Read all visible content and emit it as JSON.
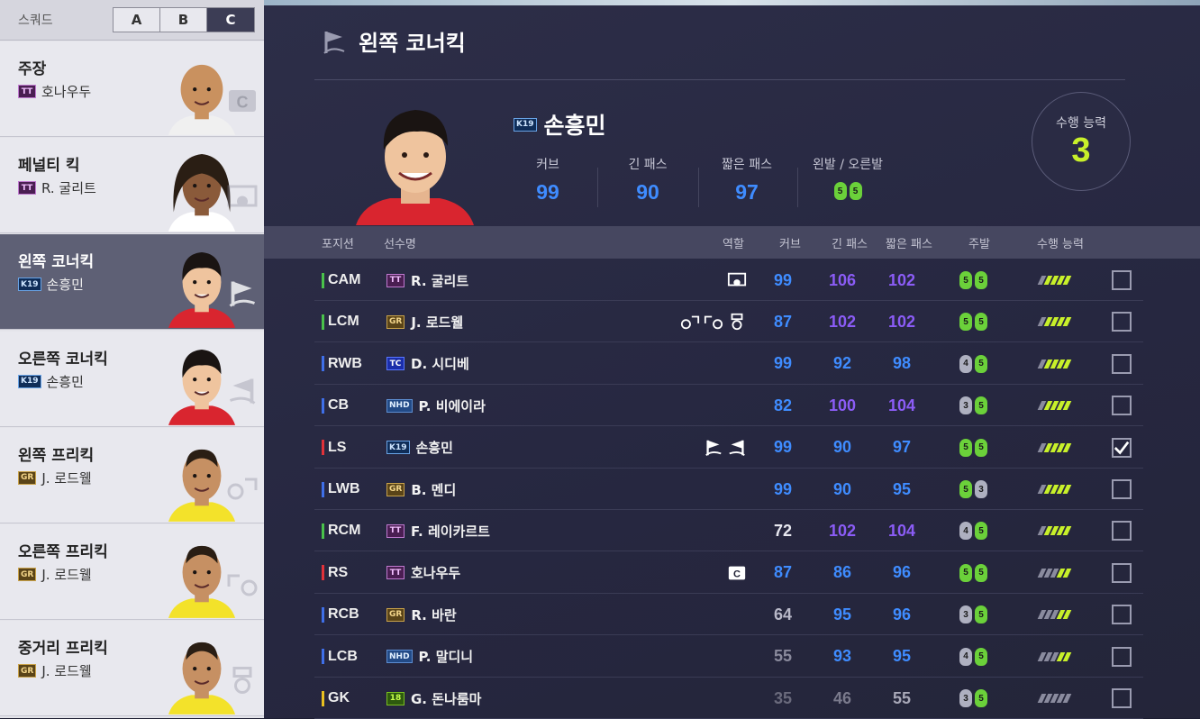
{
  "squad": {
    "label": "스쿼드",
    "tabs": [
      "A",
      "B",
      "C"
    ],
    "active": "C"
  },
  "kickers": [
    {
      "title": "주장",
      "badge": "TT",
      "player": "호나우두",
      "icon": "captain-c-icon"
    },
    {
      "title": "페널티 킥",
      "badge": "TT",
      "player": "R. 굴리트",
      "icon": "penalty-kick-icon"
    },
    {
      "title": "왼쪽 코너킥",
      "badge": "K19",
      "player": "손흥민",
      "icon": "left-corner-flag-icon",
      "active": true
    },
    {
      "title": "오른쪽 코너킥",
      "badge": "K19",
      "player": "손흥민",
      "icon": "right-corner-flag-icon"
    },
    {
      "title": "왼쪽 프리킥",
      "badge": "GR",
      "player": "J. 로드웰",
      "icon": "left-free-kick-icon"
    },
    {
      "title": "오른쪽 프리킥",
      "badge": "GR",
      "player": "J. 로드웰",
      "icon": "right-free-kick-icon"
    },
    {
      "title": "중거리 프리킥",
      "badge": "GR",
      "player": "J. 로드웰",
      "icon": "long-free-kick-icon"
    }
  ],
  "panel": {
    "title": "왼쪽 코너킥"
  },
  "hero": {
    "badge": "K19",
    "name": "손흥민",
    "stats": [
      {
        "label": "커브",
        "value": "99"
      },
      {
        "label": "긴 패스",
        "value": "90"
      },
      {
        "label": "짧은 패스",
        "value": "97"
      }
    ],
    "feet_label": "왼발 / 오른발",
    "feet": [
      "5",
      "5"
    ],
    "ability_label": "수행 능력",
    "ability_value": "3"
  },
  "table": {
    "headers": {
      "position": "포지션",
      "name": "선수명",
      "role": "역할",
      "curve": "커브",
      "long": "긴 패스",
      "short": "짧은 패스",
      "foot": "주발",
      "ability": "수행 능력"
    },
    "rows": [
      {
        "pos": "CAM",
        "bar": "#49c24a",
        "badge": "TT",
        "name": "R. 굴리트",
        "roles": [
          "penalty-kick-icon"
        ],
        "curve": "99",
        "long": "106",
        "short": "102",
        "cc": "#3f8cff",
        "lc": "#8b5cf6",
        "sc": "#8b5cf6",
        "feet": [
          "5",
          "5"
        ],
        "fc": [
          "g",
          "g"
        ],
        "perf": 4,
        "checked": false
      },
      {
        "pos": "LCM",
        "bar": "#49c24a",
        "badge": "GR",
        "name": "J. 로드웰",
        "roles": [
          "left-free-kick-icon",
          "right-free-kick-icon",
          "long-free-kick-icon"
        ],
        "curve": "87",
        "long": "102",
        "short": "102",
        "cc": "#3f8cff",
        "lc": "#8b5cf6",
        "sc": "#8b5cf6",
        "feet": [
          "5",
          "5"
        ],
        "fc": [
          "g",
          "g"
        ],
        "perf": 4,
        "checked": false
      },
      {
        "pos": "RWB",
        "bar": "#3f6fe8",
        "badge": "TC",
        "name": "D. 시디베",
        "roles": [],
        "curve": "99",
        "long": "92",
        "short": "98",
        "cc": "#3f8cff",
        "lc": "#3f8cff",
        "sc": "#3f8cff",
        "feet": [
          "4",
          "5"
        ],
        "fc": [
          "w",
          "g"
        ],
        "perf": 4,
        "checked": false
      },
      {
        "pos": "CB",
        "bar": "#3f6fe8",
        "badge": "NHD",
        "name": "P. 비에이라",
        "roles": [],
        "curve": "82",
        "long": "100",
        "short": "104",
        "cc": "#3f8cff",
        "lc": "#8b5cf6",
        "sc": "#8b5cf6",
        "feet": [
          "3",
          "5"
        ],
        "fc": [
          "w",
          "g"
        ],
        "perf": 4,
        "checked": false
      },
      {
        "pos": "LS",
        "bar": "#e0323a",
        "badge": "K19",
        "name": "손흥민",
        "roles": [
          "left-corner-flag-icon",
          "right-corner-flag-icon"
        ],
        "curve": "99",
        "long": "90",
        "short": "97",
        "cc": "#3f8cff",
        "lc": "#3f8cff",
        "sc": "#3f8cff",
        "feet": [
          "5",
          "5"
        ],
        "fc": [
          "g",
          "g"
        ],
        "perf": 4,
        "checked": true
      },
      {
        "pos": "LWB",
        "bar": "#3f6fe8",
        "badge": "GR",
        "name": "B. 멘디",
        "roles": [],
        "curve": "99",
        "long": "90",
        "short": "95",
        "cc": "#3f8cff",
        "lc": "#3f8cff",
        "sc": "#3f8cff",
        "feet": [
          "5",
          "3"
        ],
        "fc": [
          "g",
          "w"
        ],
        "perf": 4,
        "checked": false
      },
      {
        "pos": "RCM",
        "bar": "#49c24a",
        "badge": "TT",
        "name": "F. 레이카르트",
        "roles": [],
        "curve": "72",
        "long": "102",
        "short": "104",
        "cc": "#e8e8f0",
        "lc": "#8b5cf6",
        "sc": "#8b5cf6",
        "feet": [
          "4",
          "5"
        ],
        "fc": [
          "w",
          "g"
        ],
        "perf": 4,
        "checked": false
      },
      {
        "pos": "RS",
        "bar": "#e0323a",
        "badge": "TT",
        "name": "호나우두",
        "roles": [
          "captain-c-icon"
        ],
        "curve": "87",
        "long": "86",
        "short": "96",
        "cc": "#3f8cff",
        "lc": "#3f8cff",
        "sc": "#3f8cff",
        "feet": [
          "5",
          "5"
        ],
        "fc": [
          "g",
          "g"
        ],
        "perf": 2,
        "checked": false
      },
      {
        "pos": "RCB",
        "bar": "#3f6fe8",
        "badge": "GR",
        "name": "R. 바란",
        "roles": [],
        "curve": "64",
        "long": "95",
        "short": "96",
        "cc": "#b8b8c8",
        "lc": "#3f8cff",
        "sc": "#3f8cff",
        "feet": [
          "3",
          "5"
        ],
        "fc": [
          "w",
          "g"
        ],
        "perf": 2,
        "checked": false
      },
      {
        "pos": "LCB",
        "bar": "#3f6fe8",
        "badge": "NHD",
        "name": "P. 말디니",
        "roles": [],
        "curve": "55",
        "long": "93",
        "short": "95",
        "cc": "#8a8a9c",
        "lc": "#3f8cff",
        "sc": "#3f8cff",
        "feet": [
          "4",
          "5"
        ],
        "fc": [
          "w",
          "g"
        ],
        "perf": 2,
        "checked": false
      },
      {
        "pos": "GK",
        "bar": "#e8c020",
        "badge": "18",
        "name": "G. 돈나룸마",
        "roles": [],
        "curve": "35",
        "long": "46",
        "short": "55",
        "cc": "#6a6a7c",
        "lc": "#7a7a8c",
        "sc": "#a8a8b8",
        "feet": [
          "3",
          "5"
        ],
        "fc": [
          "w",
          "g"
        ],
        "perf": 0,
        "checked": false
      }
    ]
  },
  "colors": {
    "accent_lime": "#c8f02a",
    "stat_blue": "#3f8cff",
    "stat_purple": "#8b5cf6"
  }
}
